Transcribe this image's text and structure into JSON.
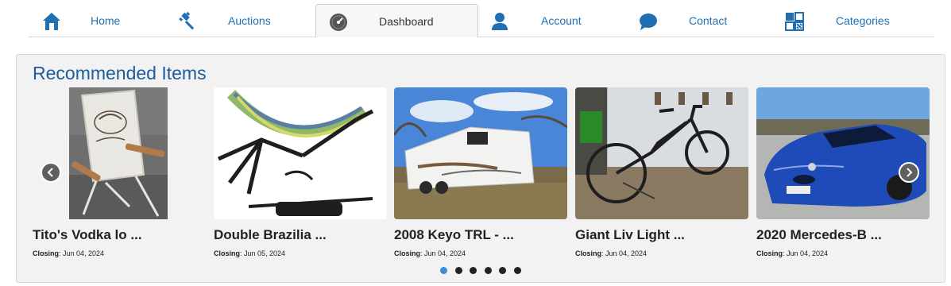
{
  "nav": {
    "tabs": [
      {
        "label": "Home",
        "icon": "home-icon",
        "active": false
      },
      {
        "label": "Auctions",
        "icon": "gavel-icon",
        "active": false
      },
      {
        "label": "Dashboard",
        "icon": "speedometer-icon",
        "active": true
      },
      {
        "label": "Account",
        "icon": "user-icon",
        "active": false
      },
      {
        "label": "Contact",
        "icon": "chat-bubble-icon",
        "active": false
      },
      {
        "label": "Categories",
        "icon": "categories-grid-icon",
        "active": false
      }
    ]
  },
  "recommended": {
    "title": "Recommended Items",
    "closing_label": "Closing",
    "items": [
      {
        "title": "Tito's Vodka lo ...",
        "closing_date": ": Jun 04, 2024"
      },
      {
        "title": "Double Brazilia ...",
        "closing_date": ": Jun 05, 2024"
      },
      {
        "title": "2008 Keyo TRL - ...",
        "closing_date": ": Jun 04, 2024"
      },
      {
        "title": "Giant Liv Light ...",
        "closing_date": ": Jun 04, 2024"
      },
      {
        "title": "2020 Mercedes-B ...",
        "closing_date": ": Jun 04, 2024"
      }
    ],
    "pagination": {
      "pages": 6,
      "current": 1
    }
  },
  "colors": {
    "link": "#1f6fb2",
    "title": "#1d5c9e",
    "dot_active": "#3a8ed6"
  }
}
